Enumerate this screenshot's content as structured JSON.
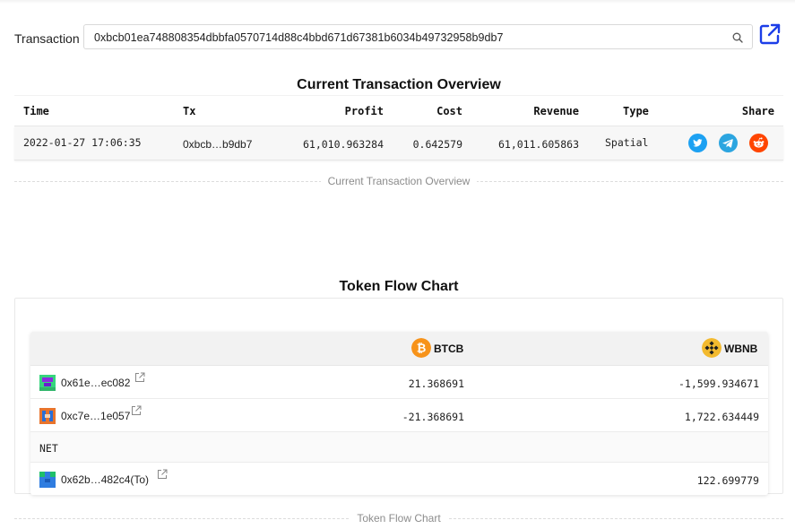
{
  "transaction": {
    "label": "Transaction",
    "hash": "0xbcb01ea748808354dbbfa0570714d88c4bbd671d67381b6034b49732958b9db7"
  },
  "overview": {
    "title": "Current Transaction Overview",
    "columns": [
      "Time",
      "Tx",
      "Profit",
      "Cost",
      "Revenue",
      "Type",
      "Share"
    ],
    "row": {
      "time": "2022-01-27 17:06:35",
      "tx": "0xbcb…b9db7",
      "profit": "61,010.963284",
      "cost": "0.642579",
      "revenue": "61,011.605863",
      "type": "Spatial"
    },
    "share_icons": [
      "twitter-icon",
      "telegram-icon",
      "reddit-icon"
    ],
    "divider_label": "Current Transaction Overview"
  },
  "token_flow": {
    "title": "Token Flow Chart",
    "tokens": [
      {
        "symbol": "BTCB",
        "icon": "bitcoin-icon",
        "color": "#f7931a"
      },
      {
        "symbol": "WBNB",
        "icon": "bnb-icon",
        "color": "#f3ba2f"
      }
    ],
    "rows": [
      {
        "address": "0x61e…ec082",
        "btcb": "21.368691",
        "wbnb": "-1,599.934671"
      },
      {
        "address": "0xc7e…1e057",
        "btcb": "-21.368691",
        "wbnb": "1,722.634449"
      },
      {
        "net_label": "NET"
      },
      {
        "address": "0x62b…482c4(To)",
        "btcb": "",
        "wbnb": "122.699779"
      }
    ],
    "divider_label": "Token Flow Chart"
  },
  "colors": {
    "accent": "#1c3ee8",
    "twitter": "#1da1f2",
    "telegram": "#2ca5e0",
    "reddit": "#ff4500"
  }
}
